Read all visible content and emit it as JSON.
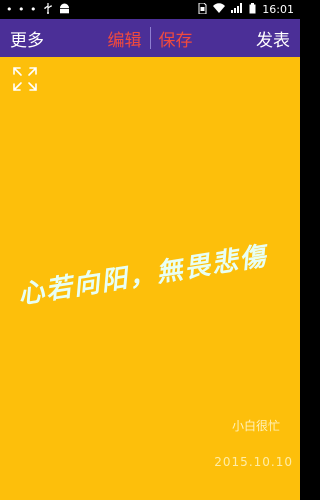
{
  "status_bar": {
    "notification_dots": "• • •",
    "icons": [
      "usb-icon",
      "android-icon",
      "sim-icon",
      "wifi-icon",
      "signal-icon",
      "battery-icon"
    ],
    "time": "16:01"
  },
  "app_bar": {
    "more_label": "更多",
    "edit_label": "编辑",
    "save_label": "保存",
    "publish_label": "发表",
    "background": "#4B2F97",
    "accent": "#F04A3E"
  },
  "canvas": {
    "background": "#FDBF0B",
    "calligraphy_text": "心若向阳，無畏悲傷",
    "signature": "小白很忙",
    "date": "2015.10.10"
  }
}
